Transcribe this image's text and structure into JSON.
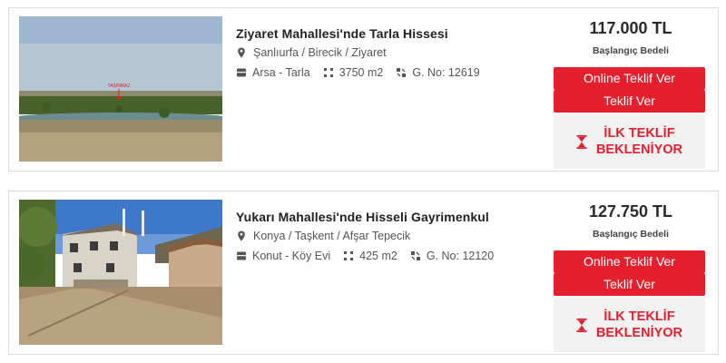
{
  "listings": [
    {
      "title": "Ziyaret Mahallesi'nde Tarla Hissesi",
      "location": "Şanlıurfa / Birecik / Ziyaret",
      "type": "Arsa - Tarla",
      "area": "3750 m2",
      "listing_no": "G. No: 12619",
      "price": "117.000 TL",
      "price_label": "Başlangıç Bedeli",
      "online_btn": "Online Teklif Ver",
      "offer_btn": "Teklif Ver",
      "status_text": "İLK TEKLİF\nBEKLENİYOR",
      "image_marker": "TAŞINMAZ"
    },
    {
      "title": "Yukarı Mahallesi'nde Hisseli Gayrimenkul",
      "location": "Konya / Taşkent / Afşar Tepecik",
      "type": "Konut - Köy Evi",
      "area": "425 m2",
      "listing_no": "G. No: 12120",
      "price": "127.750 TL",
      "price_label": "Başlangıç Bedeli",
      "online_btn": "Online Teklif Ver",
      "offer_btn": "Teklif Ver",
      "status_text": "İLK TEKLİF\nBEKLENİYOR"
    }
  ],
  "colors": {
    "accent": "#e5202e",
    "status_bg": "#f2f2f2"
  }
}
